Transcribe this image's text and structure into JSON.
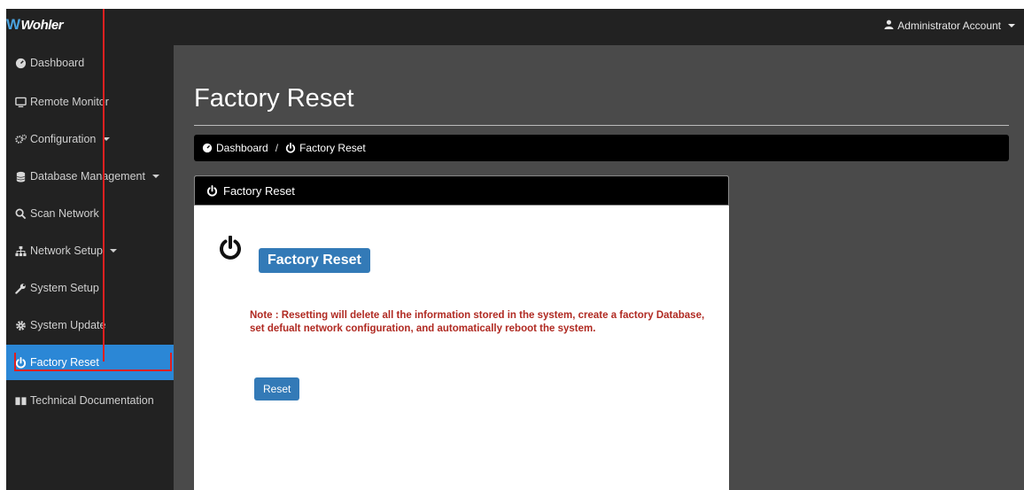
{
  "header": {
    "logo_text": "Wohler",
    "account_label": "Administrator Account"
  },
  "sidebar": {
    "items": [
      {
        "label": "Dashboard",
        "icon": "dashboard-icon"
      },
      {
        "label": "Remote Monitor",
        "icon": "monitor-icon"
      },
      {
        "label": "Configuration",
        "icon": "gears-icon",
        "has_dropdown": true
      },
      {
        "label": "Database Management",
        "icon": "database-icon",
        "has_dropdown": true
      },
      {
        "label": "Scan Network",
        "icon": "search-icon"
      },
      {
        "label": "Network Setup",
        "icon": "sitemap-icon",
        "has_dropdown": true
      },
      {
        "label": "System Setup",
        "icon": "wrench-icon"
      },
      {
        "label": "System Update",
        "icon": "gear-icon"
      },
      {
        "label": "Factory Reset",
        "icon": "power-icon",
        "active": true
      },
      {
        "label": "Technical Documentation",
        "icon": "book-icon"
      }
    ]
  },
  "main": {
    "title": "Factory Reset",
    "breadcrumb": {
      "home": "Dashboard",
      "separator": "/",
      "current": "Factory Reset"
    },
    "panel": {
      "header": "Factory Reset",
      "badge": "Factory Reset",
      "note": "Note : Resetting will delete all the information stored in the system, create a factory Database, set defualt network configuration, and automatically reboot the system.",
      "reset_button": "Reset"
    }
  },
  "colors": {
    "active": "#2b87d6",
    "primary": "#337ab7",
    "note": "#b02a22",
    "annotation": "#e02020"
  }
}
